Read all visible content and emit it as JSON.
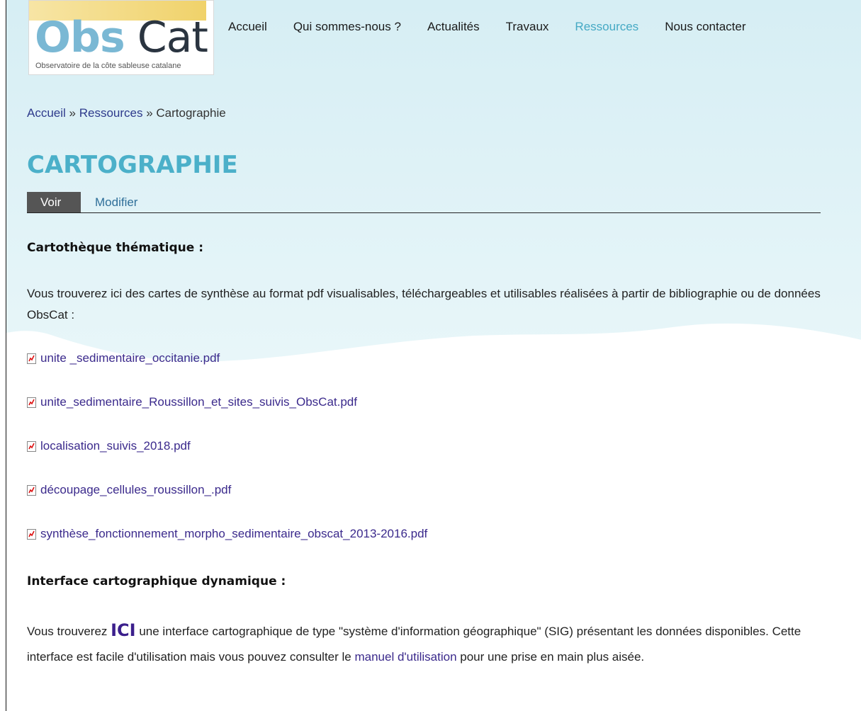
{
  "logo": {
    "title_obs": "Obs",
    "title_cat": "Cat",
    "subtitle": "Observatoire de la côte sableuse catalane"
  },
  "nav": {
    "items": [
      {
        "label": "Accueil"
      },
      {
        "label": "Qui sommes-nous ?"
      },
      {
        "label": "Actualités"
      },
      {
        "label": "Travaux"
      },
      {
        "label": "Ressources"
      },
      {
        "label": "Nous contacter"
      }
    ],
    "active_item": "Ressources"
  },
  "breadcrumb": {
    "home": "Accueil",
    "sep1": " » ",
    "parent": "Ressources",
    "sep2": " » ",
    "current": "Cartographie"
  },
  "page": {
    "title": "CARTOGRAPHIE"
  },
  "tabs": {
    "view": "Voir",
    "edit": "Modifier"
  },
  "cartotheque": {
    "heading": "Cartothèque thématique :",
    "intro": "Vous trouverez ici des cartes de synthèse au format pdf visualisables, téléchargeables et utilisables réalisées à partir de bibliographie ou de données ObsCat :",
    "files": [
      {
        "name": "unite _sedimentaire_occitanie.pdf"
      },
      {
        "name": "unite_sedimentaire_Roussillon_et_sites_suivis_ObsCat.pdf"
      },
      {
        "name": "localisation_suivis_2018.pdf"
      },
      {
        "name": "découpage_cellules_roussillon_.pdf"
      },
      {
        "name": "synthèse_fonctionnement_morpho_sedimentaire_obscat_2013-2016.pdf"
      }
    ]
  },
  "interface": {
    "heading": "Interface cartographique dynamique :",
    "text_before": "Vous trouverez ",
    "ici_link": "ICI",
    "text_mid": " une interface cartographique de type \"système d'information géographique\" (SIG) présentant les données disponibles. Cette interface est facile d'utilisation mais vous pouvez consulter le ",
    "manual_link": "manuel d'utilisation",
    "text_after": " pour une prise en main plus aisée."
  },
  "colors": {
    "accent": "#4bb0c9",
    "link": "#3b2a8c",
    "nav_active": "#45a9c4",
    "tab_active_bg": "#555555",
    "header_bg": "#e4f4f8"
  },
  "icons": {
    "pdf": "pdf-file-icon"
  }
}
